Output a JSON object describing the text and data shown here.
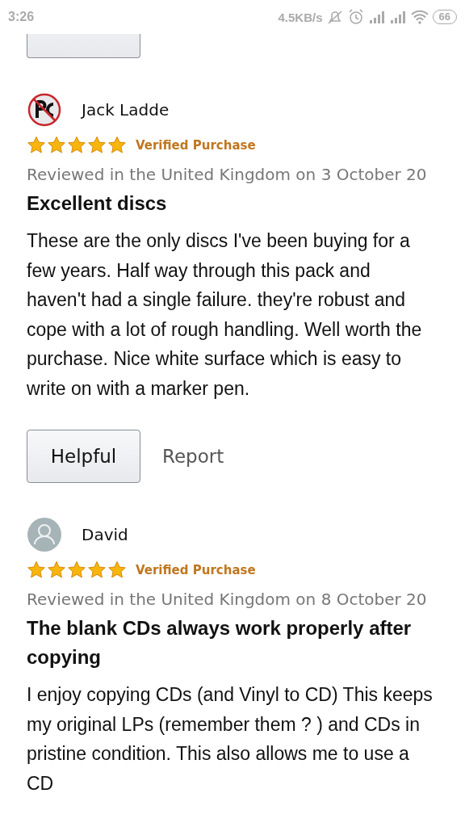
{
  "status_bar": {
    "time": "3:26",
    "speed": "4.5KB/s",
    "battery": "66"
  },
  "reviews": [
    {
      "kind": "partial"
    },
    {
      "kind": "full",
      "avatar": {
        "kind": "logo"
      },
      "author": "Jack Ladde",
      "stars": 5,
      "badge": "Verified Purchase",
      "date": "Reviewed in the United Kingdom on 3 October 20",
      "title": "Excellent discs",
      "body": "These are the only discs I've been buying for a few years. Half way through this pack and haven't had a single failure. they're robust and cope with a lot of rough handling. Well worth the purchase. Nice white surface which is easy to write on with a marker pen.",
      "buttons": {
        "helpful": "Helpful",
        "report": "Report"
      }
    },
    {
      "kind": "full",
      "avatar": {
        "kind": "default"
      },
      "author": "David",
      "stars": 5,
      "badge": "Verified Purchase",
      "date": "Reviewed in the United Kingdom on 8 October 20",
      "title": "The blank CDs always work properly after copying",
      "body": "I enjoy copying CDs (and Vinyl to CD) This keeps my original LPs (remember them ? ) and CDs in pristine condition. This also allows me to use a CD"
    }
  ]
}
